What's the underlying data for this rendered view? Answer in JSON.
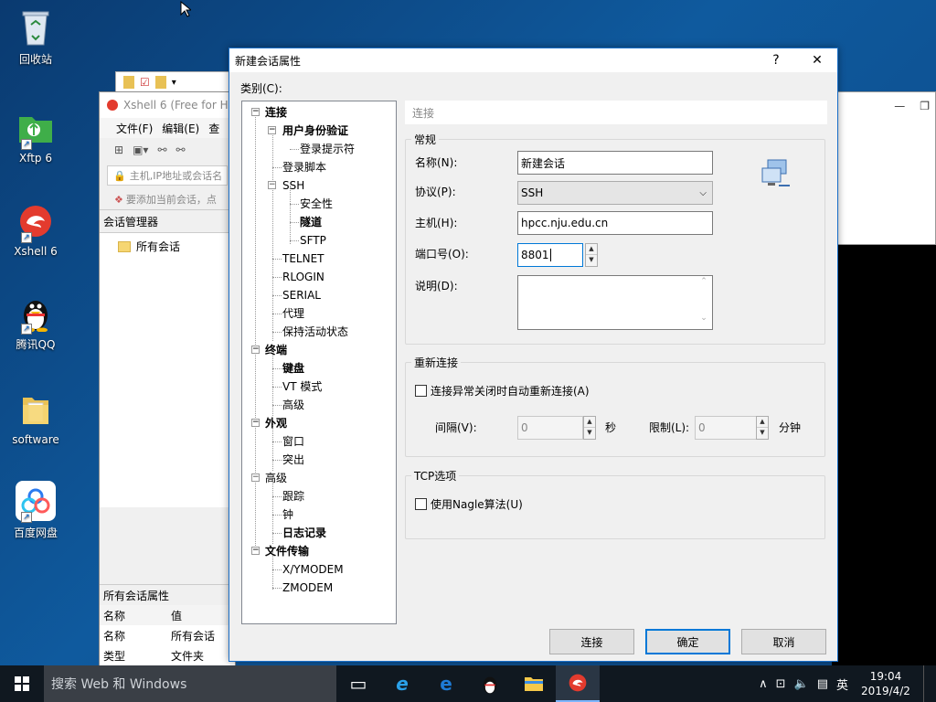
{
  "desktop": {
    "icons": [
      {
        "label": "回收站"
      },
      {
        "label": "Xftp 6"
      },
      {
        "label": "Xshell 6"
      },
      {
        "label": "腾讯QQ"
      },
      {
        "label": "software"
      },
      {
        "label": "百度网盘"
      }
    ]
  },
  "xshell": {
    "title": "Xshell 6 (Free for Ho",
    "menu": [
      "文件(F)",
      "编辑(E)",
      "查"
    ],
    "address_placeholder": "主机,IP地址或会话名",
    "hint": "要添加当前会话，点",
    "session_manager": "会话管理器",
    "all_sessions": "所有会话",
    "props_title": "所有会话属性",
    "props_head": {
      "name": "名称",
      "value": "值"
    },
    "props_rows": [
      {
        "name": "名称",
        "value": "所有会话"
      },
      {
        "name": "类型",
        "value": "文件夹"
      }
    ]
  },
  "dialog": {
    "title": "新建会话属性",
    "help": "?",
    "close": "✕",
    "category_label": "类别(C):",
    "tree": [
      "连接",
      "用户身份验证",
      "登录提示符",
      "登录脚本",
      "SSH",
      "安全性",
      "隧道",
      "SFTP",
      "TELNET",
      "RLOGIN",
      "SERIAL",
      "代理",
      "保持活动状态",
      "终端",
      "键盘",
      "VT 模式",
      "高级",
      "外观",
      "窗口",
      "突出",
      "高级",
      "跟踪",
      "钟",
      "日志记录",
      "文件传输",
      "X/YMODEM",
      "ZMODEM"
    ],
    "section_title": "连接",
    "general": {
      "legend": "常规",
      "name_label": "名称(N):",
      "name_value": "新建会话",
      "protocol_label": "协议(P):",
      "protocol_value": "SSH",
      "host_label": "主机(H):",
      "host_value": "hpcc.nju.edu.cn",
      "port_label": "端口号(O):",
      "port_value": "8801",
      "desc_label": "说明(D):",
      "desc_value": ""
    },
    "reconnect": {
      "legend": "重新连接",
      "checkbox": "连接异常关闭时自动重新连接(A)",
      "interval_label": "间隔(V):",
      "interval_value": "0",
      "interval_unit": "秒",
      "limit_label": "限制(L):",
      "limit_value": "0",
      "limit_unit": "分钟"
    },
    "tcp": {
      "legend": "TCP选项",
      "checkbox": "使用Nagle算法(U)"
    },
    "buttons": {
      "connect": "连接",
      "ok": "确定",
      "cancel": "取消"
    }
  },
  "taskbar": {
    "search": "搜索 Web 和 Windows",
    "ime": "英",
    "time": "19:04",
    "date": "2019/4/2"
  },
  "colors": {
    "accent": "#0078d7",
    "desktop": "#0d4a86"
  }
}
